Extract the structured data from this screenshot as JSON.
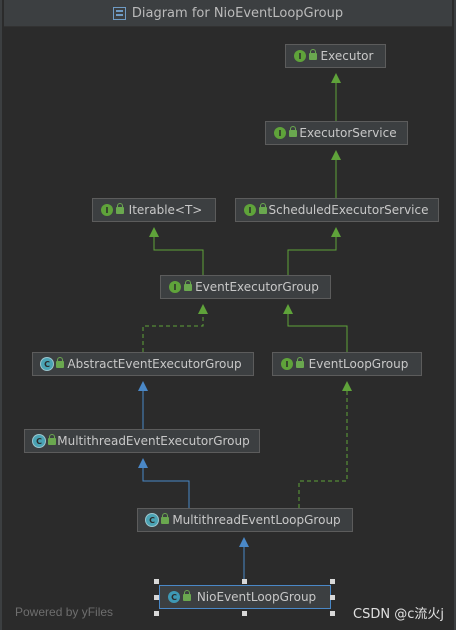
{
  "window": {
    "title": "Diagram for NioEventLoopGroup"
  },
  "nodes": {
    "executor": {
      "label": "Executor",
      "kind": "interface",
      "badge": "I"
    },
    "executor_service": {
      "label": "ExecutorService",
      "kind": "interface",
      "badge": "I"
    },
    "iterable": {
      "label": "Iterable<T>",
      "kind": "interface",
      "badge": "I"
    },
    "scheduled_executor_service": {
      "label": "ScheduledExecutorService",
      "kind": "interface",
      "badge": "I"
    },
    "event_executor_group": {
      "label": "EventExecutorGroup",
      "kind": "interface",
      "badge": "I"
    },
    "abstract_event_executor_group": {
      "label": "AbstractEventExecutorGroup",
      "kind": "abstract",
      "badge": "C"
    },
    "event_loop_group": {
      "label": "EventLoopGroup",
      "kind": "interface",
      "badge": "I"
    },
    "multithread_event_executor_group": {
      "label": "MultithreadEventExecutorGroup",
      "kind": "abstract",
      "badge": "C"
    },
    "multithread_event_loop_group": {
      "label": "MultithreadEventLoopGroup",
      "kind": "abstract",
      "badge": "C"
    },
    "nio_event_loop_group": {
      "label": "NioEventLoopGroup",
      "kind": "class",
      "badge": "C"
    }
  },
  "edges": [
    {
      "from": "executor_service",
      "to": "executor",
      "type": "extends-interface"
    },
    {
      "from": "scheduled_executor_service",
      "to": "executor_service",
      "type": "extends-interface"
    },
    {
      "from": "event_executor_group",
      "to": "iterable",
      "type": "extends-interface"
    },
    {
      "from": "event_executor_group",
      "to": "scheduled_executor_service",
      "type": "extends-interface"
    },
    {
      "from": "abstract_event_executor_group",
      "to": "event_executor_group",
      "type": "implements"
    },
    {
      "from": "event_loop_group",
      "to": "event_executor_group",
      "type": "extends-interface"
    },
    {
      "from": "multithread_event_executor_group",
      "to": "abstract_event_executor_group",
      "type": "extends-class"
    },
    {
      "from": "multithread_event_loop_group",
      "to": "multithread_event_executor_group",
      "type": "extends-class"
    },
    {
      "from": "multithread_event_loop_group",
      "to": "event_loop_group",
      "type": "implements"
    },
    {
      "from": "nio_event_loop_group",
      "to": "multithread_event_loop_group",
      "type": "extends-class"
    }
  ],
  "colors": {
    "interface_edge": "#5fa33a",
    "class_edge": "#4a88c7",
    "selected_border": "#4a88c7"
  },
  "footer": {
    "powered_by": "Powered by yFiles"
  },
  "watermark": "CSDN @c流火j"
}
